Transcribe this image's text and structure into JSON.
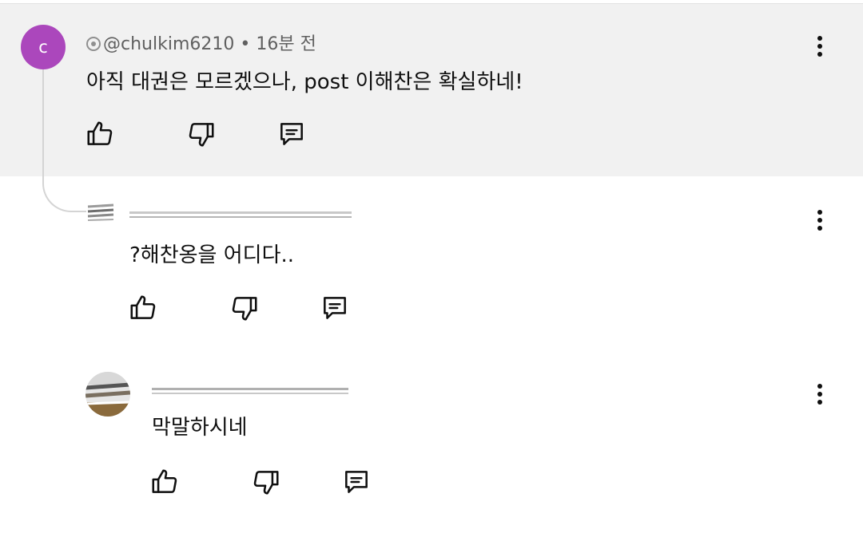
{
  "comments": [
    {
      "author_handle": "@chulkim6210",
      "time_ago": "16분 전",
      "avatar_letter": "c",
      "avatar_color": "#ab47bc",
      "text": "아직 대권은 모르겠으나, post 이해찬은 확실하네!"
    },
    {
      "author_handle": "",
      "time_ago": "",
      "text": "?해찬옹을 어디다.."
    },
    {
      "author_handle": "",
      "time_ago": "",
      "text": "막말하시네"
    }
  ],
  "icons": {
    "like": "thumbs-up-icon",
    "dislike": "thumbs-down-icon",
    "reply": "reply-comment-icon",
    "more": "more-vertical-icon"
  },
  "colors": {
    "highlight_bg": "#f1f1f1",
    "avatar_purple": "#ab47bc",
    "text_primary": "#0f0f0f",
    "text_secondary": "#606060"
  }
}
